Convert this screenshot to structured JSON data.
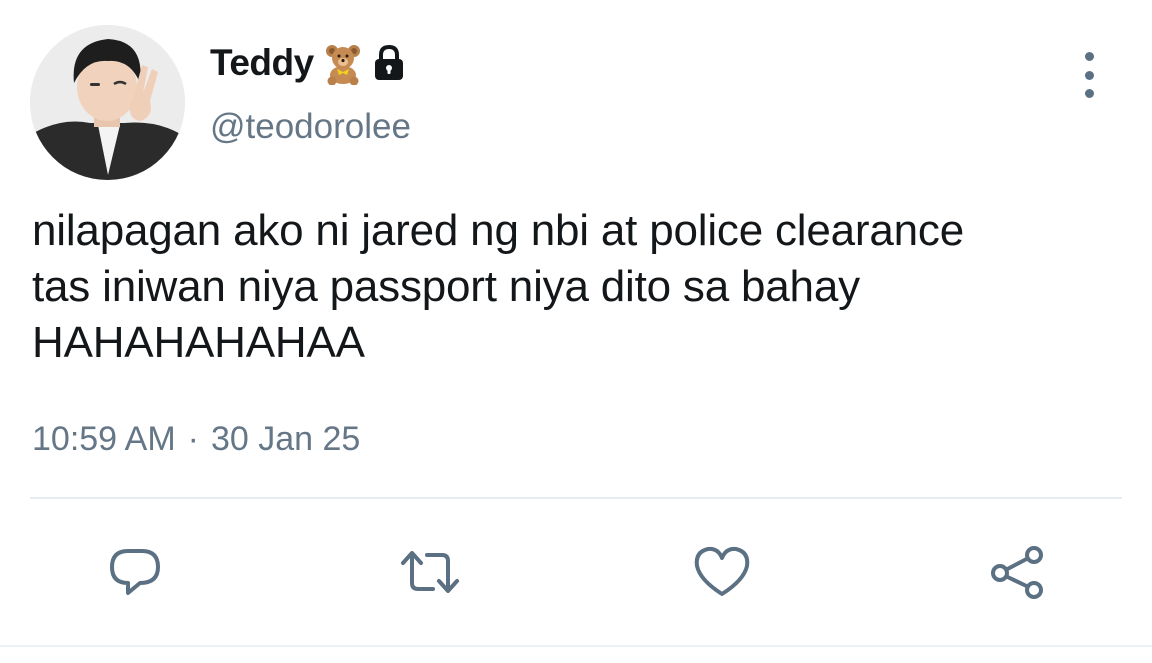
{
  "user": {
    "display_name": "Teddy",
    "handle": "@teodorolee",
    "badges": [
      "teddy-bear-emoji",
      "lock-icon"
    ]
  },
  "tweet": {
    "text": "nilapagan ako ni jared ng nbi at police clearance\ntas iniwan niya passport niya dito sa bahay\nHAHAHAHAHAA",
    "time": "10:59 AM",
    "separator": "·",
    "date": "30 Jan 25"
  },
  "actions": {
    "icons": [
      "reply-icon",
      "retweet-icon",
      "like-icon",
      "share-icon"
    ]
  },
  "colors": {
    "text": "#14171a",
    "secondary": "#657786",
    "icon": "#5b7083",
    "divider": "#e6ecf0"
  }
}
